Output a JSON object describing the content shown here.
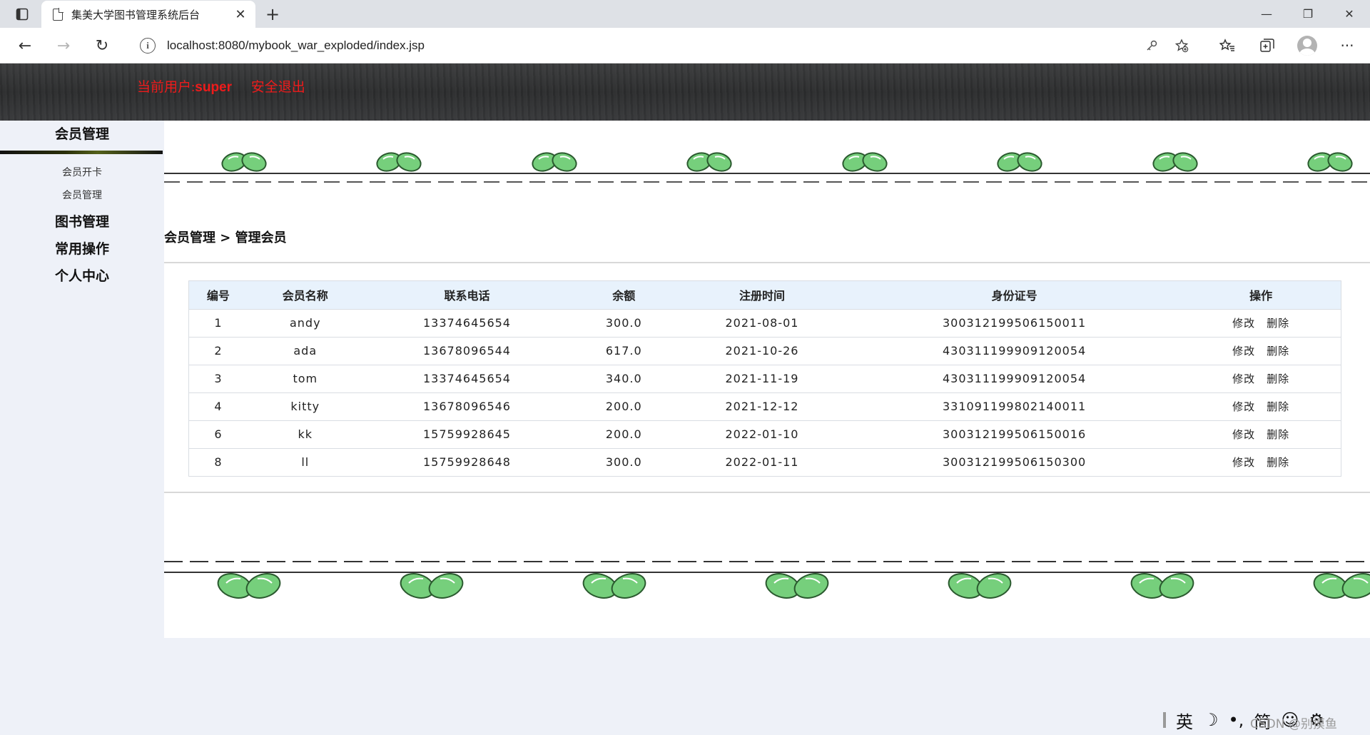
{
  "browser": {
    "tab_title": "集美大学图书管理系统后台",
    "new_tab": "+",
    "tab_close": "✕",
    "url": "localhost:8080/mybook_war_exploded/index.jsp",
    "info_icon": "i",
    "back": "←",
    "forward": "→",
    "reload": "↻",
    "minimize": "—",
    "restore": "❐",
    "close": "✕",
    "more": "···"
  },
  "header": {
    "user_prefix": "当前用户:",
    "user_name": "super",
    "logout": "安全退出",
    "color": "#ee1b1b"
  },
  "sidebar": {
    "sections": [
      {
        "label": "会员管理",
        "items": [
          "会员开卡",
          "会员管理"
        ]
      },
      {
        "label": "图书管理"
      },
      {
        "label": "常用操作"
      },
      {
        "label": "个人中心"
      }
    ]
  },
  "breadcrumb": "会员管理 > 管理会员",
  "table": {
    "headers": [
      "编号",
      "会员名称",
      "联系电话",
      "余额",
      "注册时间",
      "身份证号",
      "操作"
    ],
    "rows": [
      [
        "1",
        "andy",
        "13374645654",
        "300.0",
        "2021-08-01",
        "300312199506150011"
      ],
      [
        "2",
        "ada",
        "13678096544",
        "617.0",
        "2021-10-26",
        "430311199909120054"
      ],
      [
        "3",
        "tom",
        "13374645654",
        "340.0",
        "2021-11-19",
        "430311199909120054"
      ],
      [
        "4",
        "kitty",
        "13678096546",
        "200.0",
        "2021-12-12",
        "331091199802140011"
      ],
      [
        "6",
        "kk",
        "15759928645",
        "200.0",
        "2022-01-10",
        "300312199506150016"
      ],
      [
        "8",
        "ll",
        "15759928648",
        "300.0",
        "2022-01-11",
        "300312199506150300"
      ]
    ],
    "edit_label": "修改",
    "delete_label": "删除",
    "header_bg": "#e8f2fc"
  },
  "ime": {
    "lang": "英",
    "moon": "☽",
    "punct": "•,",
    "mode": "简",
    "emoji": "☺",
    "settings": "⚙",
    "watermark": "CSDN @别摸鱼"
  }
}
